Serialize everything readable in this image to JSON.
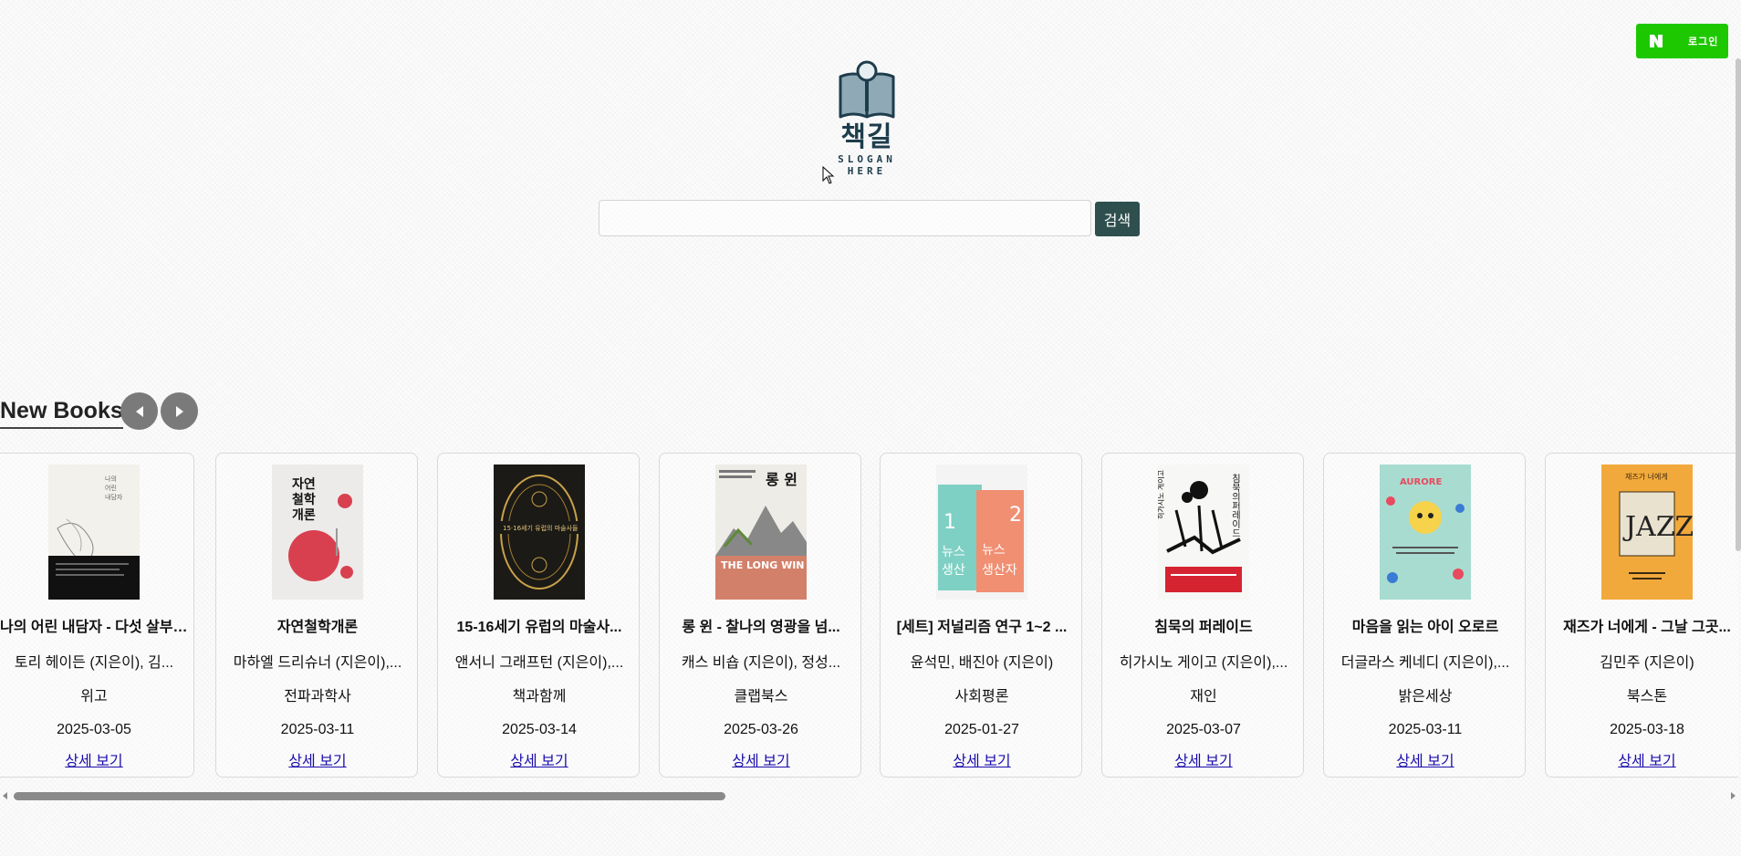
{
  "header": {
    "login_label": "로그인",
    "login_icon": "naver-n-icon",
    "login_color": "#1ec800"
  },
  "logo": {
    "title": "책길",
    "slogan": "SLOGAN HERE",
    "icon": "book-magnifier-icon"
  },
  "search": {
    "value": "",
    "placeholder": "",
    "button_label": "검색"
  },
  "section": {
    "title": "New Books",
    "prev_icon": "triangle-left-icon",
    "next_icon": "triangle-right-icon"
  },
  "books": [
    {
      "title": "나의 어린 내담자 - 다섯 살부터 열다섯 살까지",
      "author": "토리 헤이든 (지은이), 김...",
      "publisher": "위고",
      "date": "2025-03-05",
      "detail_label": "상세 보기"
    },
    {
      "title": "자연철학개론",
      "author": "마하엘 드리슈너 (지은이),...",
      "publisher": "전파과학사",
      "date": "2025-03-11",
      "detail_label": "상세 보기"
    },
    {
      "title": "15-16세기 유럽의 마술사...",
      "author": "앤서니 그래프턴 (지은이),...",
      "publisher": "책과함께",
      "date": "2025-03-14",
      "detail_label": "상세 보기"
    },
    {
      "title": "롱 윈 - 찰나의 영광을 넘...",
      "author": "캐스 비숍 (지은이), 정성...",
      "publisher": "클랩북스",
      "date": "2025-03-26",
      "detail_label": "상세 보기"
    },
    {
      "title": "[세트] 저널리즘 연구 1~2 ...",
      "author": "윤석민, 배진아 (지은이)",
      "publisher": "사회평론",
      "date": "2025-01-27",
      "detail_label": "상세 보기"
    },
    {
      "title": "침묵의 퍼레이드",
      "author": "히가시노 게이고 (지은이),...",
      "publisher": "재인",
      "date": "2025-03-07",
      "detail_label": "상세 보기"
    },
    {
      "title": "마음을 읽는 아이 오로르",
      "author": "더글라스 케네디 (지은이),...",
      "publisher": "밝은세상",
      "date": "2025-03-11",
      "detail_label": "상세 보기"
    },
    {
      "title": "재즈가 너에게 - 그날 그곳...",
      "author": "김민주 (지은이)",
      "publisher": "북스톤",
      "date": "2025-03-18",
      "detail_label": "상세 보기"
    }
  ],
  "covers": {
    "book1": {
      "text": "나의 어린 내담자",
      "icon": "book-cover-1"
    },
    "book2": {
      "text": "자연 철학 개론",
      "icon": "book-cover-2"
    },
    "book3": {
      "text": "15·16세기 유럽의 마술사들",
      "icon": "book-cover-3"
    },
    "book4": {
      "text": "롱 윈",
      "sub": "THE LONG WIN",
      "icon": "book-cover-4"
    },
    "book5": {
      "text": "뉴스 생산자",
      "icon": "book-cover-5"
    },
    "book6": {
      "text": "침묵의 퍼레이드",
      "icon": "book-cover-6"
    },
    "book7": {
      "text": "AURORE",
      "icon": "book-cover-7"
    },
    "book8": {
      "text": "재즈가 너에게",
      "icon": "book-cover-8"
    }
  }
}
